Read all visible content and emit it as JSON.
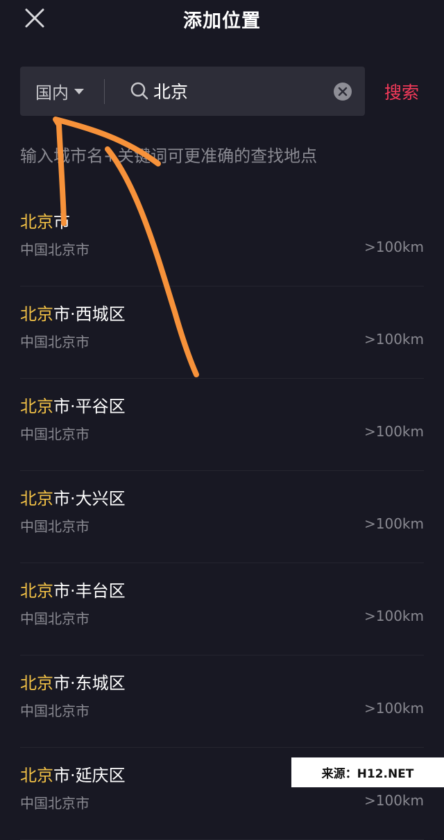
{
  "header": {
    "title": "添加位置"
  },
  "search": {
    "region_label": "国内",
    "value": "北京",
    "button_label": "搜索"
  },
  "hint": "输入城市名+关键词可更准确的查找地点",
  "results": [
    {
      "highlight": "北京",
      "rest": "市",
      "address": "中国北京市",
      "distance": ">100km"
    },
    {
      "highlight": "北京",
      "rest": "市·西城区",
      "address": "中国北京市",
      "distance": ">100km"
    },
    {
      "highlight": "北京",
      "rest": "市·平谷区",
      "address": "中国北京市",
      "distance": ">100km"
    },
    {
      "highlight": "北京",
      "rest": "市·大兴区",
      "address": "中国北京市",
      "distance": ">100km"
    },
    {
      "highlight": "北京",
      "rest": "市·丰台区",
      "address": "中国北京市",
      "distance": ">100km"
    },
    {
      "highlight": "北京",
      "rest": "市·东城区",
      "address": "中国北京市",
      "distance": ">100km"
    },
    {
      "highlight": "北京",
      "rest": "市·延庆区",
      "address": "中国北京市",
      "distance": ">100km"
    }
  ],
  "watermark": "来源：H12.NET",
  "colors": {
    "background": "#181823",
    "highlight": "#f3c246",
    "accent": "#f53a5a",
    "annotation": "#f7923a"
  },
  "icons": {
    "close": "close-icon",
    "caret": "caret-down-icon",
    "search": "search-icon",
    "clear": "clear-icon"
  }
}
